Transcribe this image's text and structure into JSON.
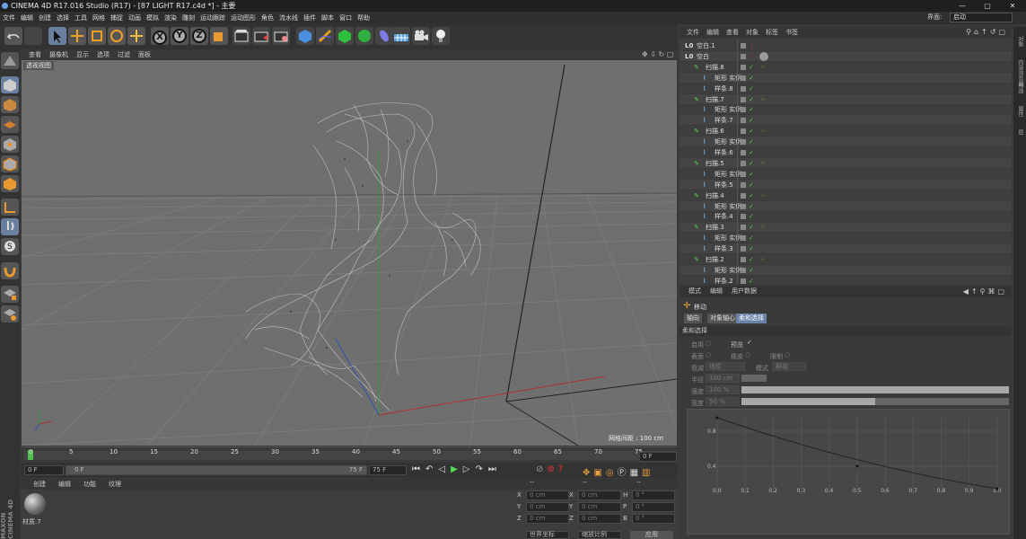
{
  "window": {
    "title": "CINEMA 4D R17.016 Studio (R17) - [87 LIGHT R17.c4d *] - 主要",
    "minimize": "—",
    "maximize": "▢",
    "close": "✕"
  },
  "menu": [
    "文件",
    "编辑",
    "创建",
    "选择",
    "工具",
    "网格",
    "捕捉",
    "动画",
    "模拟",
    "渲染",
    "雕刻",
    "运动跟踪",
    "运动图形",
    "角色",
    "流水线",
    "插件",
    "脚本",
    "窗口",
    "帮助"
  ],
  "layout": {
    "label": "界面:",
    "value": "启动"
  },
  "toolbar": {
    "undo": "undo-icon",
    "redo": "redo-icon",
    "x": "X",
    "y": "Y",
    "z": "Z"
  },
  "viewport": {
    "menu": [
      "查看",
      "摄像机",
      "显示",
      "选项",
      "过滤",
      "面板"
    ],
    "label": "透视视图",
    "grid_label": "网格间距 : 100 cm"
  },
  "timeline": {
    "ticks": [
      "0",
      "5",
      "10",
      "15",
      "20",
      "25",
      "30",
      "35",
      "40",
      "45",
      "50",
      "55",
      "60",
      "65",
      "70",
      "75"
    ],
    "right_field": "0 F"
  },
  "transport": {
    "start": "0 F",
    "range_start": "0 F",
    "range_end": "75 F",
    "end": "75 F"
  },
  "material": {
    "menu": [
      "创建",
      "编辑",
      "功能",
      "纹理"
    ],
    "item_name": "材质.7"
  },
  "coords": {
    "header": [
      "--",
      "--",
      "--"
    ],
    "rows": [
      {
        "a": "X",
        "av": "0 cm",
        "b": "X",
        "bv": "0 cm",
        "c": "H",
        "cv": "0 °"
      },
      {
        "a": "Y",
        "av": "0 cm",
        "b": "Y",
        "bv": "0 cm",
        "c": "P",
        "cv": "0 °"
      },
      {
        "a": "Z",
        "av": "0 cm",
        "b": "Z",
        "bv": "0 cm",
        "c": "B",
        "cv": "0 °"
      }
    ],
    "sel1": "世界坐标",
    "sel2": "缩放比例",
    "apply": "应用"
  },
  "objects": {
    "menu": [
      "文件",
      "编辑",
      "查看",
      "对象",
      "标签",
      "书签"
    ],
    "rows": [
      {
        "name": "空白.1",
        "indent": 0
      },
      {
        "name": "空白",
        "indent": 0
      },
      {
        "name": "扫描.8",
        "indent": 1
      },
      {
        "name": "矩形 实例",
        "indent": 2
      },
      {
        "name": "样条.8",
        "indent": 2
      },
      {
        "name": "扫描.7",
        "indent": 1
      },
      {
        "name": "矩形 实例",
        "indent": 2
      },
      {
        "name": "样条.7",
        "indent": 2
      },
      {
        "name": "扫描.6",
        "indent": 1
      },
      {
        "name": "矩形 实例",
        "indent": 2
      },
      {
        "name": "样条.6",
        "indent": 2
      },
      {
        "name": "扫描.5",
        "indent": 1
      },
      {
        "name": "矩形 实例",
        "indent": 2
      },
      {
        "name": "样条.5",
        "indent": 2
      },
      {
        "name": "扫描.4",
        "indent": 1
      },
      {
        "name": "矩形 实例",
        "indent": 2
      },
      {
        "name": "样条.4",
        "indent": 2
      },
      {
        "name": "扫描.3",
        "indent": 1
      },
      {
        "name": "矩形 实例",
        "indent": 2
      },
      {
        "name": "样条.3",
        "indent": 2
      },
      {
        "name": "扫描.2",
        "indent": 1
      },
      {
        "name": "矩形 实例",
        "indent": 2
      },
      {
        "name": "样条.2",
        "indent": 2
      }
    ]
  },
  "attributes": {
    "menu": [
      "模式",
      "编辑",
      "用户数据"
    ],
    "tool": "移动",
    "tabs": [
      "轴向",
      "对象轴心",
      "柔和选择"
    ],
    "section": "柔和选择",
    "enable": "启用",
    "preview": "预览",
    "surface": "表面",
    "rubber": "橡皮",
    "restrict": "限制",
    "falloff_label": "衰减",
    "falloff_value": "线性",
    "mode_label": "模式",
    "mode_value": "群组",
    "radius_label": "半径",
    "radius_value": "100 cm",
    "strength_label": "强度",
    "strength_value": "100 %",
    "width_label": "宽度",
    "width_value": "50 %",
    "strength_fraction": 1.0,
    "width_fraction": 0.5,
    "graph": {
      "x_ticks": [
        "0.0",
        "0.1",
        "0.2",
        "0.3",
        "0.4",
        "0.5",
        "0.6",
        "0.7",
        "0.8",
        "0.9",
        "1.0"
      ],
      "y_ticks": [
        "0.8",
        "0.4"
      ]
    }
  },
  "right_tabs": [
    "对象",
    "内容浏览器",
    "构造",
    "属性",
    "层"
  ],
  "brand": "MAXON CINEMA 4D"
}
